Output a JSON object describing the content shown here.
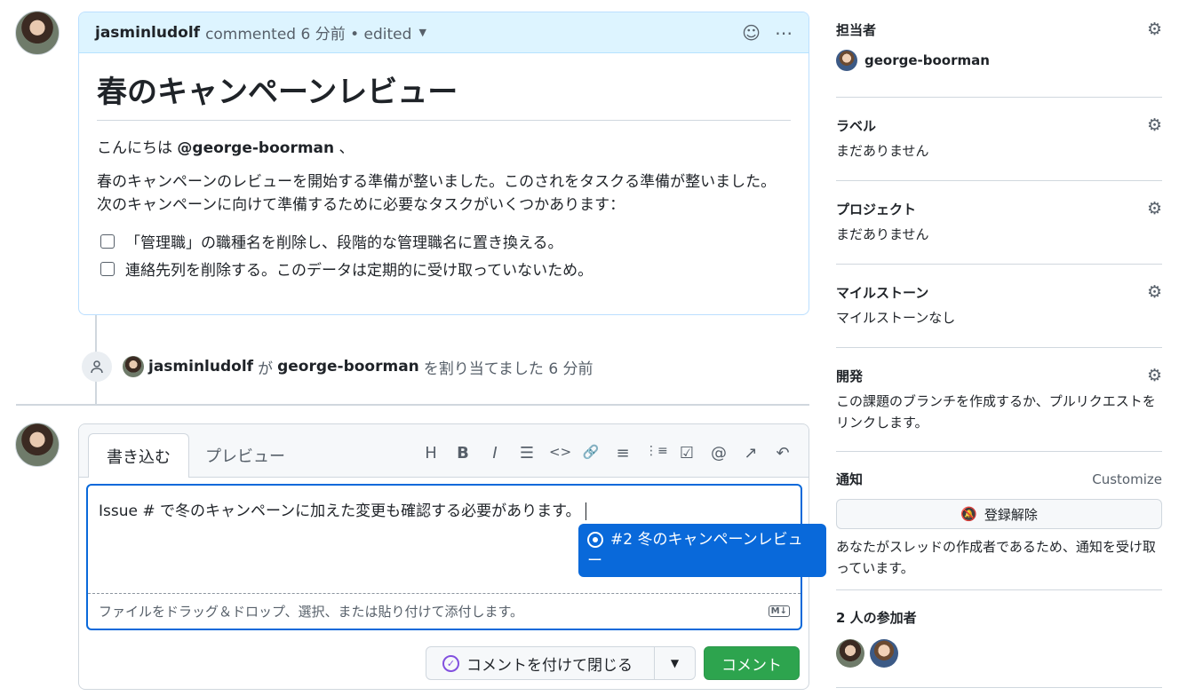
{
  "comment": {
    "author": "jasminludolf",
    "meta": "commented 6 分前 • edited",
    "title": "春のキャンペーンレビュー",
    "greeting_prefix": "こんにちは ",
    "greeting_mention": "@george-boorman",
    "greeting_suffix": " 、",
    "paragraph_line1": "春のキャンペーンのレビューを開始する準備が整いました。このされをタスクる準備が整いました。",
    "paragraph_line2": "次のキャンペーンに向けて準備するために必要なタスクがいくつかあります：",
    "tasks": [
      "「管理職」の職種名を削除し、段階的な管理職名に置き換える。",
      "連絡先列を削除する。このデータは定期的に受け取っていないため。"
    ]
  },
  "event": {
    "actor": "jasminludolf",
    "particle": "が",
    "assignee": "george-boorman",
    "action": "を割り当てました 6 分前"
  },
  "editor": {
    "tab_write": "書き込む",
    "tab_preview": "プレビュー",
    "toolbar": [
      "H",
      "B",
      "I",
      "☰",
      "<>",
      "🔗",
      "≡",
      "⋮≡",
      "☑",
      "@",
      "↗",
      "↶"
    ],
    "text": "Issue # で冬のキャンペーンに加えた変更も確認する必要があります。",
    "attach_hint": "ファイルをドラッグ＆ドロップ、選択、または貼り付けて添付します。",
    "md_badge": "M↓",
    "suggestion_line1": "#2 冬のキャンペーンレビュ",
    "suggestion_line2": "ー",
    "close_button": "コメントを付けて閉じる",
    "comment_button": "コメント"
  },
  "sidebar": {
    "assignees_label": "担当者",
    "assignee": "george-boorman",
    "labels_label": "ラベル",
    "labels_value": "まだありません",
    "projects_label": "プロジェクト",
    "projects_value": "まだありません",
    "milestone_label": "マイルストーン",
    "milestone_value": "マイルストーンなし",
    "development_label": "開発",
    "development_value": "この課題のブランチを作成するか、プルリクエストをリンクします。",
    "notifications_label": "通知",
    "customize": "Customize",
    "unsubscribe": "登録解除",
    "notifications_reason": "あなたがスレッドの作成者であるため、通知を受け取っています。",
    "participants_label": "2 人の参加者"
  },
  "colors": {
    "accent": "#0969da",
    "success": "#2da44e",
    "header_bg": "#ddf4ff"
  }
}
